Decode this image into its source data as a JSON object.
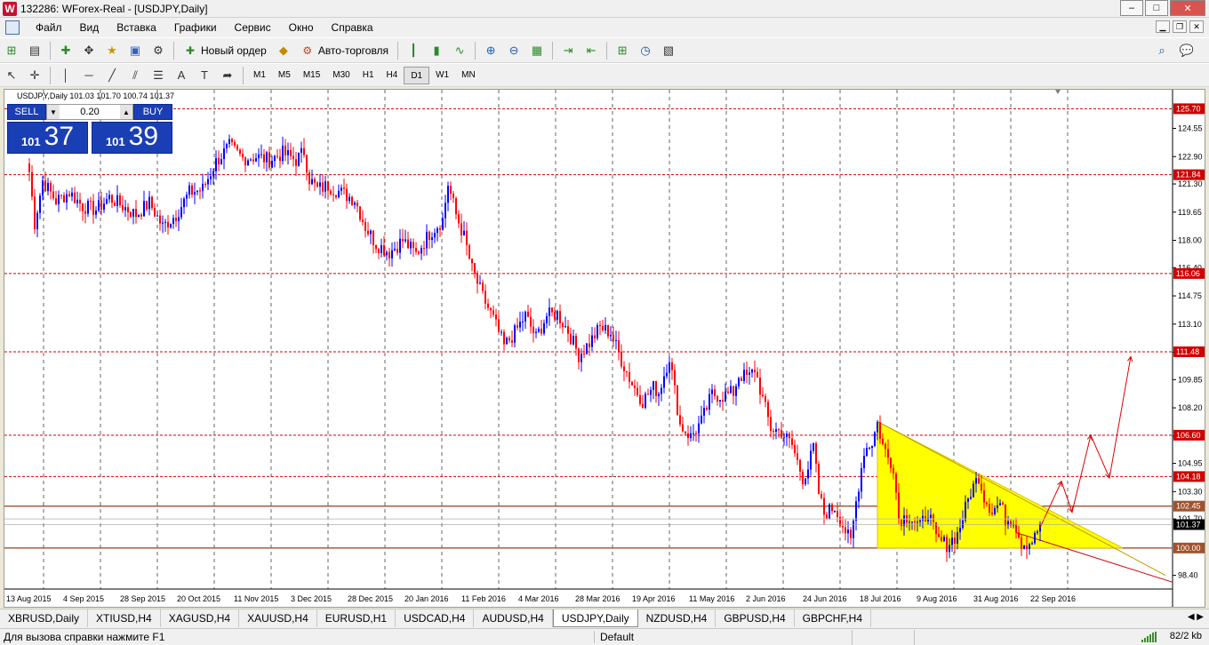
{
  "window": {
    "title": "132286: WForex-Real - [USDJPY,Daily]",
    "logo": "W",
    "minimize": "–",
    "maximize": "□",
    "close": "✕"
  },
  "menu": [
    "Файл",
    "Вид",
    "Вставка",
    "Графики",
    "Сервис",
    "Окно",
    "Справка"
  ],
  "toolbar": {
    "new_order": "Новый ордер",
    "auto_trading": "Авто-торговля",
    "timeframes": [
      "M1",
      "M5",
      "M15",
      "M30",
      "H1",
      "H4",
      "D1",
      "W1",
      "MN"
    ],
    "active_timeframe": "D1"
  },
  "chart": {
    "symbol_info": "USDJPY,Daily  101.03 101.70 100.74 101.37",
    "trade_panel": {
      "sell_label": "SELL",
      "buy_label": "BUY",
      "lot": "0.20",
      "sell_small": "101",
      "sell_big": "37",
      "buy_small": "101",
      "buy_big": "39"
    }
  },
  "chart_data": {
    "type": "candlestick",
    "symbol": "USDJPY",
    "timeframe": "Daily",
    "ylim": [
      97.6,
      126.5
    ],
    "y_ticks": [
      "124.55",
      "122.90",
      "121.30",
      "119.65",
      "118.00",
      "116.40",
      "114.75",
      "113.10",
      "111.45",
      "109.85",
      "108.20",
      "106.55",
      "104.95",
      "103.30",
      "101.70",
      "98.40"
    ],
    "x_labels": [
      "13 Aug 2015",
      "4 Sep 2015",
      "28 Sep 2015",
      "20 Oct 2015",
      "11 Nov 2015",
      "3 Dec 2015",
      "28 Dec 2015",
      "20 Jan 2016",
      "11 Feb 2016",
      "4 Mar 2016",
      "28 Mar 2016",
      "19 Apr 2016",
      "11 May 2016",
      "2 Jun 2016",
      "24 Jun 2016",
      "18 Jul 2016",
      "9 Aug 2016",
      "31 Aug 2016",
      "22 Sep 2016"
    ],
    "h_levels": [
      {
        "label": "125.70",
        "value": 125.7,
        "style": "dashed"
      },
      {
        "label": "121.84",
        "value": 121.84,
        "style": "dashed"
      },
      {
        "label": "116.06",
        "value": 116.06,
        "style": "dashed"
      },
      {
        "label": "111.48",
        "value": 111.48,
        "style": "dashed"
      },
      {
        "label": "106.60",
        "value": 106.6,
        "style": "dashed"
      },
      {
        "label": "104.18",
        "value": 104.18,
        "style": "dashed"
      },
      {
        "label": "102.45",
        "value": 102.45,
        "style": "solid"
      },
      {
        "label": "100.00",
        "value": 100.0,
        "style": "solid"
      }
    ],
    "current_price": {
      "label": "101.37",
      "value": 101.37
    },
    "ask_line": 101.7,
    "path": [
      [
        0,
        122.0
      ],
      [
        2,
        119.0
      ],
      [
        5,
        121.5
      ],
      [
        10,
        120.3
      ],
      [
        15,
        120.8
      ],
      [
        20,
        120.0
      ],
      [
        25,
        119.8
      ],
      [
        30,
        120.5
      ],
      [
        35,
        120.0
      ],
      [
        40,
        119.5
      ],
      [
        45,
        120.2
      ],
      [
        50,
        118.8
      ],
      [
        55,
        119.5
      ],
      [
        60,
        120.8
      ],
      [
        65,
        121.0
      ],
      [
        70,
        122.6
      ],
      [
        75,
        123.5
      ],
      [
        80,
        122.8
      ],
      [
        85,
        122.9
      ],
      [
        90,
        122.7
      ],
      [
        95,
        123.1
      ],
      [
        100,
        122.7
      ],
      [
        103,
        123.2
      ],
      [
        105,
        121.6
      ],
      [
        108,
        121.0
      ],
      [
        112,
        121.2
      ],
      [
        118,
        120.7
      ],
      [
        122,
        120.4
      ],
      [
        126,
        118.8
      ],
      [
        130,
        117.8
      ],
      [
        135,
        117.3
      ],
      [
        140,
        118.0
      ],
      [
        145,
        117.2
      ],
      [
        150,
        118.4
      ],
      [
        155,
        119.2
      ],
      [
        157,
        121.3
      ],
      [
        160,
        119.5
      ],
      [
        163,
        118.2
      ],
      [
        166,
        116.3
      ],
      [
        170,
        114.7
      ],
      [
        174,
        113.4
      ],
      [
        178,
        111.8
      ],
      [
        182,
        112.6
      ],
      [
        186,
        113.6
      ],
      [
        190,
        112.3
      ],
      [
        194,
        113.6
      ],
      [
        198,
        113.7
      ],
      [
        202,
        112.7
      ],
      [
        206,
        111.3
      ],
      [
        210,
        112.0
      ],
      [
        214,
        112.9
      ],
      [
        218,
        112.6
      ],
      [
        222,
        111.0
      ],
      [
        226,
        109.6
      ],
      [
        230,
        108.6
      ],
      [
        234,
        109.4
      ],
      [
        236,
        109.1
      ],
      [
        240,
        111.2
      ],
      [
        242,
        109.2
      ],
      [
        244,
        107.2
      ],
      [
        248,
        106.5
      ],
      [
        252,
        107.4
      ],
      [
        256,
        109.0
      ],
      [
        260,
        108.9
      ],
      [
        264,
        109.1
      ],
      [
        266,
        110.1
      ],
      [
        270,
        110.0
      ],
      [
        272,
        110.5
      ],
      [
        275,
        108.7
      ],
      [
        278,
        107.0
      ],
      [
        282,
        106.8
      ],
      [
        286,
        106.0
      ],
      [
        290,
        104.1
      ],
      [
        292,
        104.7
      ],
      [
        294,
        105.9
      ],
      [
        296,
        103.2
      ],
      [
        298,
        102.0
      ],
      [
        302,
        102.4
      ],
      [
        304,
        101.7
      ],
      [
        308,
        100.3
      ],
      [
        310,
        102.7
      ],
      [
        313,
        105.7
      ],
      [
        316,
        106.2
      ],
      [
        318,
        107.3
      ],
      [
        320,
        106.0
      ],
      [
        322,
        105.3
      ],
      [
        324,
        104.8
      ],
      [
        326,
        101.7
      ],
      [
        330,
        101.9
      ],
      [
        334,
        101.2
      ],
      [
        337,
        102.2
      ],
      [
        340,
        100.5
      ],
      [
        344,
        100.2
      ],
      [
        348,
        100.8
      ],
      [
        351,
        102.3
      ],
      [
        353,
        103.3
      ],
      [
        356,
        104.2
      ],
      [
        358,
        103.0
      ],
      [
        361,
        102.2
      ],
      [
        364,
        102.6
      ],
      [
        366,
        101.7
      ],
      [
        369,
        101.7
      ],
      [
        372,
        100.3
      ],
      [
        375,
        100.3
      ],
      [
        377,
        100.6
      ],
      [
        379,
        101.4
      ]
    ],
    "triangle": [
      [
        318,
        107.4
      ],
      [
        318,
        100.0
      ],
      [
        410,
        100.0
      ]
    ],
    "forecast": [
      [
        379,
        101.2
      ],
      [
        387,
        103.9
      ],
      [
        391,
        102.1
      ],
      [
        398,
        106.6
      ],
      [
        405,
        104.1
      ],
      [
        413,
        111.2
      ]
    ],
    "trend_line": [
      [
        318,
        107.4
      ],
      [
        426,
        98.4
      ]
    ]
  },
  "tabs": [
    "XBRUSD,Daily",
    "XTIUSD,H4",
    "XAGUSD,H4",
    "XAUUSD,H4",
    "EURUSD,H1",
    "USDCAD,H4",
    "AUDUSD,H4",
    "USDJPY,Daily",
    "NZDUSD,H4",
    "GBPUSD,H4",
    "GBPCHF,H4"
  ],
  "active_tab": "USDJPY,Daily",
  "status": {
    "help": "Для вызова справки нажмите F1",
    "profile": "Default",
    "traffic": "82/2 kb"
  }
}
